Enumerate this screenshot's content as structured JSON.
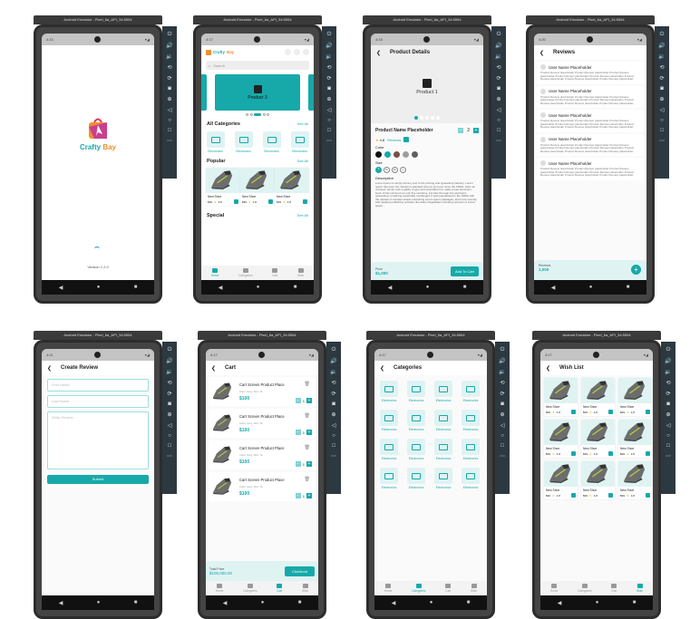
{
  "emulator_title": "Android Emulator - Pixel_6a_API_34:5554",
  "accent_color": "#17a9a9",
  "toolbar_icons": [
    "power-icon",
    "volume-up-icon",
    "volume-down-icon",
    "rotate-left-icon",
    "rotate-right-icon",
    "camera-icon",
    "zoom-icon",
    "back-icon",
    "home-icon",
    "overview-icon",
    "more-icon"
  ],
  "times": [
    "4:15",
    "4:17",
    "4:18",
    "4:20",
    "4:21",
    "4:17",
    "4:17",
    "4:17"
  ],
  "bottom_nav": [
    "Home",
    "Categories",
    "Cart",
    "Wish"
  ],
  "splash": {
    "brand_first": "Crafty",
    "brand_second": "Bay",
    "version": "Version 1.2.0"
  },
  "home": {
    "brand_first": "Crafty",
    "brand_second": "Bay",
    "search_placeholder": "Search",
    "banner": "Product 3",
    "all_categories": "All Categories",
    "popular": "Popular",
    "special": "Special",
    "see_all": "See All",
    "categories": [
      "Electronics",
      "Electronics",
      "Electronics",
      "Electronics"
    ],
    "products": [
      {
        "name": "New Shoe",
        "price": "$99",
        "rating": "4.8"
      },
      {
        "name": "New Shoe",
        "price": "$99",
        "rating": "4.8"
      },
      {
        "name": "New Shoe",
        "price": "$99",
        "rating": "4.8"
      }
    ]
  },
  "details": {
    "title": "Product Details",
    "image_label": "Product 1",
    "name": "Product Name Placeholder",
    "quantity": "2",
    "rating": "4.8",
    "reviews_link": "Reviews",
    "color_label": "Color",
    "colors": [
      "#111111",
      "#17a9a9",
      "#7a5044",
      "#9e9e9e",
      "#5f5f5f"
    ],
    "size_label": "Size",
    "sizes": [
      "S",
      "XL",
      "2L",
      "L"
    ],
    "description_label": "Description",
    "description": "Lorem Ipsum is simply dummy text of the printing and typesetting industry. Lorem Ipsum has been the industry's standard dummy text ever since the 1500s, when an unknown printer took a galley of type and scrambled it to make a type specimen book. It has survived not only five centuries, but also the leap into electronic typesetting, remaining essentially unchanged. It was popularised in the 1960s with the release of Letraset sheets containing Lorem Ipsum passages, and more recently with desktop publishing software like Aldus PageMaker including versions of Lorem Ipsum.",
    "price_label": "Price",
    "price": "$1,000",
    "add_to_cart": "Add To Cart"
  },
  "reviews": {
    "title": "Reviews",
    "items": [
      {
        "user": "User Name Placeholder",
        "text": "Product Review placeholder Product Review placeholder Product Review placeholder Product Review placeholder Product Review placeholder Product Review placeholder Product Review placeholder Product Review placeholder"
      },
      {
        "user": "User Name Placeholder",
        "text": "Product Review placeholder Product Review placeholder Product Review placeholder Product Review placeholder Product Review placeholder Product Review placeholder Product Review placeholder Product Review placeholder"
      },
      {
        "user": "User Name Placeholder",
        "text": "Product Review placeholder Product Review placeholder Product Review placeholder Product Review placeholder Product Review placeholder Product Review placeholder Product Review placeholder Product Review placeholder"
      },
      {
        "user": "User Name Placeholder",
        "text": "Product Review placeholder Product Review placeholder Product Review placeholder Product Review placeholder Product Review placeholder Product Review placeholder Product Review placeholder Product Review placeholder"
      },
      {
        "user": "User Name Placeholder",
        "text": "Product Review placeholder Product Review placeholder Product Review placeholder Product Review placeholder Product Review placeholder Product Review placeholder Product Review placeholder Product Review placeholder"
      }
    ],
    "footer_label": "Reviews",
    "footer_count": "1,000"
  },
  "create_review": {
    "title": "Create Review",
    "first_name_placeholder": "First Name",
    "last_name_placeholder": "Last Name",
    "review_placeholder": "Write Review",
    "submit": "Submit"
  },
  "cart": {
    "title": "Cart",
    "items": [
      {
        "name": "Cart Screen Product Place",
        "variant": "Color: Grey, Size: XL",
        "price": "$100",
        "qty": "1"
      },
      {
        "name": "Cart Screen Product Place",
        "variant": "Color: Grey, Size: XL",
        "price": "$100",
        "qty": "1"
      },
      {
        "name": "Cart Screen Product Place",
        "variant": "Color: Grey, Size: XL",
        "price": "$100",
        "qty": "1"
      },
      {
        "name": "Cart Screen Product Place",
        "variant": "Color: Grey, Size: XL",
        "price": "$100",
        "qty": "1"
      }
    ],
    "total_label": "Total Price",
    "total": "$100,000.00",
    "checkout": "Checkout"
  },
  "categories": {
    "title": "Categories",
    "items": [
      "Electronics",
      "Electronics",
      "Electronics",
      "Electronics",
      "Electronics",
      "Electronics",
      "Electronics",
      "Electronics",
      "Electronics",
      "Electronics",
      "Electronics",
      "Electronics",
      "Electronics",
      "Electronics",
      "Electronics",
      "Electronics"
    ]
  },
  "wish": {
    "title": "Wish List",
    "items": [
      {
        "name": "New Shoe",
        "price": "$99",
        "rating": "4.8"
      },
      {
        "name": "New Shoe",
        "price": "$99",
        "rating": "4.8"
      },
      {
        "name": "New Shoe",
        "price": "$99",
        "rating": "4.8"
      },
      {
        "name": "New Shoe",
        "price": "$99",
        "rating": "4.8"
      },
      {
        "name": "New Shoe",
        "price": "$99",
        "rating": "4.8"
      },
      {
        "name": "New Shoe",
        "price": "$99",
        "rating": "4.8"
      },
      {
        "name": "New Shoe",
        "price": "$99",
        "rating": "4.8"
      },
      {
        "name": "New Shoe",
        "price": "$99",
        "rating": "4.8"
      },
      {
        "name": "New Shoe",
        "price": "$99",
        "rating": "4.8"
      }
    ]
  }
}
